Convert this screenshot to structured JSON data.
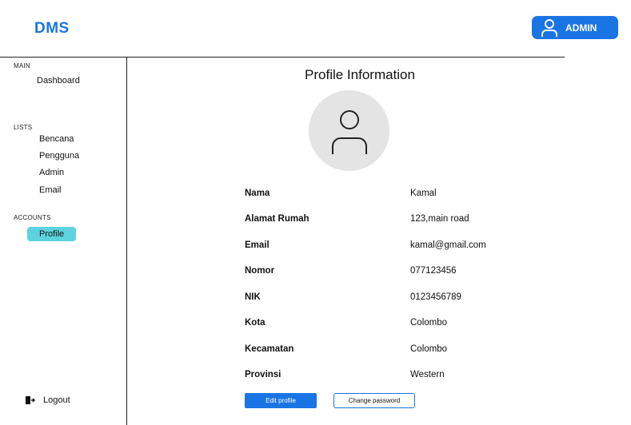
{
  "header": {
    "logo": "DMS",
    "user_button_label": "ADMIN"
  },
  "sidebar": {
    "sections": {
      "main": "MAIN",
      "lists": "LISTS",
      "accounts": "ACCOUNTS"
    },
    "items": {
      "dashboard": "Dashboard",
      "bencana": "Bencana",
      "pengguna": "Pengguna",
      "admin": "Admin",
      "email": "Email",
      "profile": "Profile"
    },
    "active_item": "Profile",
    "logout_label": "Logout"
  },
  "main": {
    "title": "Profile Information",
    "fields": [
      {
        "label": "Nama",
        "value": "Kamal"
      },
      {
        "label": "Alamat Rumah",
        "value": "123,main road"
      },
      {
        "label": "Email",
        "value": "kamal@gmail.com"
      },
      {
        "label": "Nomor",
        "value": "077123456"
      },
      {
        "label": "NIK",
        "value": "0123456789"
      },
      {
        "label": "Kota",
        "value": "Colombo"
      },
      {
        "label": "Kecamatan",
        "value": "Colombo"
      },
      {
        "label": "Provinsi",
        "value": "Western"
      }
    ],
    "edit_button": "Edit profile",
    "change_password_button": "Change password"
  },
  "colors": {
    "accent": "#1b74e4",
    "active_nav": "#5ed3e0",
    "avatar_bg": "#e4e4e4"
  }
}
